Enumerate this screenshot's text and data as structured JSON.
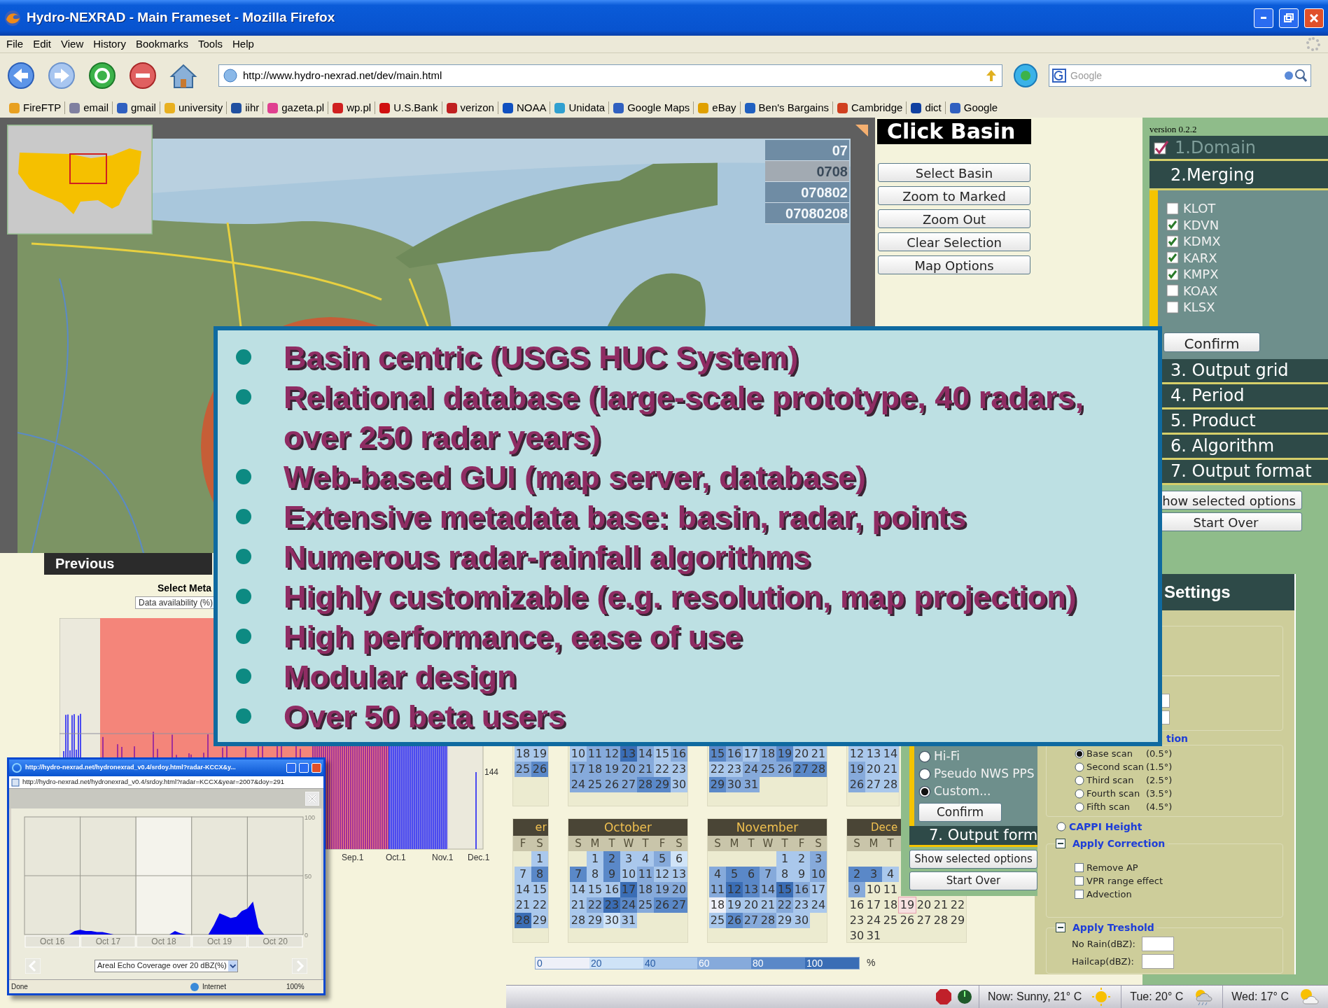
{
  "window": {
    "title": "Hydro-NEXRAD - Main Frameset - Mozilla Firefox"
  },
  "menu": [
    "File",
    "Edit",
    "View",
    "History",
    "Bookmarks",
    "Tools",
    "Help"
  ],
  "toolbar": {
    "url": "http://www.hydro-nexrad.net/dev/main.html",
    "search_placeholder": "Google"
  },
  "bookmarks": [
    {
      "label": "FireFTP",
      "color": "#e8a020"
    },
    {
      "label": "email",
      "color": "#8080a0"
    },
    {
      "label": "gmail",
      "color": "#3060c0"
    },
    {
      "label": "university",
      "color": "#e8b020"
    },
    {
      "label": "iihr",
      "color": "#2050a0"
    },
    {
      "label": "gazeta.pl",
      "color": "#e04090"
    },
    {
      "label": "wp.pl",
      "color": "#d02020"
    },
    {
      "label": "U.S.Bank",
      "color": "#d01010"
    },
    {
      "label": "verizon",
      "color": "#c02020"
    },
    {
      "label": "NOAA",
      "color": "#1050c0"
    },
    {
      "label": "Unidata",
      "color": "#30a0d0"
    },
    {
      "label": "Google Maps",
      "color": "#3060c0"
    },
    {
      "label": "eBay",
      "color": "#e0a000"
    },
    {
      "label": "Ben's Bargains",
      "color": "#2060c0"
    },
    {
      "label": "Cambridge",
      "color": "#d04020"
    },
    {
      "label": "dict",
      "color": "#1040a0"
    },
    {
      "label": "Google",
      "color": "#3060c0"
    }
  ],
  "map": {
    "basin_codes": [
      {
        "code": "07",
        "selected": false
      },
      {
        "code": "0708",
        "selected": true
      },
      {
        "code": "070802",
        "selected": false
      },
      {
        "code": "07080208",
        "selected": false
      }
    ]
  },
  "basin_panel": {
    "title": "Click Basin",
    "buttons": [
      "Select Basin",
      "Zoom to Marked",
      "Zoom Out",
      "Clear Selection",
      "Map Options"
    ]
  },
  "wizard": {
    "version": "version 0.2.2",
    "steps": [
      {
        "label": "1.Domain",
        "done": true,
        "expanded": false
      },
      {
        "label": "2.Merging",
        "done": false,
        "expanded": true
      },
      {
        "label": "3. Output grid",
        "done": false,
        "expanded": false
      },
      {
        "label": "4. Period",
        "done": false,
        "expanded": false
      },
      {
        "label": "5. Product",
        "done": false,
        "expanded": false
      },
      {
        "label": "6. Algorithm",
        "done": false,
        "expanded": false
      },
      {
        "label": "7. Output format",
        "done": false,
        "expanded": false
      }
    ],
    "radars": [
      {
        "label": "KLOT",
        "checked": false
      },
      {
        "label": "KDVN",
        "checked": true
      },
      {
        "label": "KDMX",
        "checked": true
      },
      {
        "label": "KARX",
        "checked": true
      },
      {
        "label": "KMPX",
        "checked": true
      },
      {
        "label": "KOAX",
        "checked": false
      },
      {
        "label": "KLSX",
        "checked": false
      }
    ],
    "confirm": "Confirm",
    "show_options": "how selected options",
    "start_over": "Start Over"
  },
  "previous": "Previous",
  "availability": {
    "label": "Select Meta",
    "dropdown": "Data availability (%)",
    "max_label": "144",
    "x_labels": [
      "Sep.1",
      "Oct.1",
      "Nov.1",
      "Dec.1"
    ]
  },
  "popup": {
    "title": "http://hydro-nexrad.net/hydronexrad_v0.4/srdoy.html?radar-KCCX&y...",
    "address": "http://hydro-nexrad.net/hydronexrad_v0.4/srdoy.html?radar=KCCX&year=2007&doy=291",
    "chart_data": {
      "type": "area",
      "categories": [
        null,
        null,
        null,
        null,
        null,
        "Oct 16",
        null,
        null,
        null,
        null,
        null,
        null,
        null,
        null,
        null,
        "Oct 17",
        null,
        null,
        null,
        null,
        null,
        null,
        null,
        null,
        null,
        "Oct 18",
        null,
        null,
        null,
        null,
        null,
        null,
        null,
        null,
        null,
        "Oct 19",
        null,
        null,
        null,
        null,
        null,
        null,
        null,
        null,
        null,
        "Oct 20",
        null,
        null,
        null,
        null,
        null
      ],
      "series": [
        {
          "name": "Areal Echo Coverage over 20 dBZ(%)",
          "color": "#0000ee",
          "values": [
            0,
            0,
            0,
            0,
            0,
            0,
            0,
            0,
            0,
            3,
            4,
            3,
            3,
            2,
            2,
            1,
            0,
            0,
            0,
            0,
            0,
            0,
            0,
            0,
            0,
            0,
            0,
            3,
            1,
            0,
            0,
            0,
            0,
            0,
            8,
            18,
            16,
            14,
            15,
            20,
            22,
            28,
            6,
            0,
            0,
            0,
            0,
            0,
            0,
            0,
            0
          ]
        }
      ],
      "ylim": [
        0,
        100
      ],
      "yticks": [
        0,
        50,
        100
      ]
    },
    "status": "Done",
    "zone": "Internet",
    "zoom": "100%"
  },
  "calendars": {
    "top": [
      {
        "weeks": [
          [
            {
              "kind": "day",
              "day": "18",
              "color": "#aac8ec"
            },
            {
              "kind": "day",
              "day": "19",
              "color": "#aac8ec"
            }
          ],
          [
            {
              "kind": "day",
              "day": "25",
              "color": "#86aadb"
            },
            {
              "kind": "day",
              "day": "26",
              "color": "#5a88c8"
            }
          ]
        ]
      },
      {
        "weeks": [
          [
            {
              "kind": "day",
              "day": "10",
              "color": "#aac8ec"
            },
            {
              "kind": "day",
              "day": "11",
              "color": "#86aadb"
            },
            {
              "kind": "day",
              "day": "12",
              "color": "#86aadb"
            },
            {
              "kind": "day",
              "day": "13",
              "color": "#3a6db5"
            },
            {
              "kind": "day",
              "day": "14",
              "color": "#86aadb"
            },
            {
              "kind": "day",
              "day": "15",
              "color": "#aac8ec"
            },
            {
              "kind": "day",
              "day": "16",
              "color": "#86aadb"
            }
          ],
          [
            {
              "kind": "day",
              "day": "17",
              "color": "#86aadb"
            },
            {
              "kind": "day",
              "day": "18",
              "color": "#86aadb"
            },
            {
              "kind": "day",
              "day": "19",
              "color": "#86aadb"
            },
            {
              "kind": "day",
              "day": "20",
              "color": "#86aadb"
            },
            {
              "kind": "day",
              "day": "21",
              "color": "#86aadb"
            },
            {
              "kind": "day",
              "day": "22",
              "color": "#aac8ec"
            },
            {
              "kind": "day",
              "day": "23",
              "color": "#aac8ec"
            }
          ],
          [
            {
              "kind": "day",
              "day": "24",
              "color": "#86aadb"
            },
            {
              "kind": "day",
              "day": "25",
              "color": "#86aadb"
            },
            {
              "kind": "day",
              "day": "26",
              "color": "#86aadb"
            },
            {
              "kind": "day",
              "day": "27",
              "color": "#86aadb"
            },
            {
              "kind": "day",
              "day": "28",
              "color": "#5a88c8"
            },
            {
              "kind": "day",
              "day": "29",
              "color": "#5a88c8"
            },
            {
              "kind": "day",
              "day": "30",
              "color": "#aac8ec"
            }
          ]
        ]
      },
      {
        "weeks": [
          [
            {
              "kind": "day",
              "day": "15",
              "color": "#5a88c8"
            },
            {
              "kind": "day",
              "day": "16",
              "color": "#86aadb"
            },
            {
              "kind": "day",
              "day": "17",
              "color": "#aac8ec"
            },
            {
              "kind": "day",
              "day": "18",
              "color": "#86aadb"
            },
            {
              "kind": "day",
              "day": "19",
              "color": "#5a88c8"
            },
            {
              "kind": "day",
              "day": "20",
              "color": "#aac8ec"
            },
            {
              "kind": "day",
              "day": "21",
              "color": "#aac8ec"
            }
          ],
          [
            {
              "kind": "day",
              "day": "22",
              "color": "#aac8ec"
            },
            {
              "kind": "day",
              "day": "23",
              "color": "#aac8ec"
            },
            {
              "kind": "day",
              "day": "24",
              "color": "#86aadb"
            },
            {
              "kind": "day",
              "day": "25",
              "color": "#86aadb"
            },
            {
              "kind": "day",
              "day": "26",
              "color": "#86aadb"
            },
            {
              "kind": "day",
              "day": "27",
              "color": "#5a88c8"
            },
            {
              "kind": "day",
              "day": "28",
              "color": "#5a88c8"
            }
          ],
          [
            {
              "kind": "day",
              "day": "29",
              "color": "#5a88c8"
            },
            {
              "kind": "day",
              "day": "30",
              "color": "#86aadb"
            },
            {
              "kind": "day",
              "day": "31",
              "color": "#86aadb"
            }
          ]
        ]
      },
      {
        "weeks": [
          [
            {
              "kind": "day",
              "day": "12",
              "color": "#aac8ec"
            },
            {
              "kind": "day",
              "day": "13",
              "color": "#aac8ec"
            },
            {
              "kind": "day",
              "day": "14",
              "color": "#aac8ec"
            }
          ],
          [
            {
              "kind": "day",
              "day": "19",
              "color": "#86aadb"
            },
            {
              "kind": "day",
              "day": "20",
              "color": "#aac8ec"
            },
            {
              "kind": "day",
              "day": "21",
              "color": "#aac8ec"
            }
          ],
          [
            {
              "kind": "day",
              "day": "26",
              "color": "#86aadb"
            },
            {
              "kind": "day",
              "day": "27",
              "color": "#aac8ec"
            },
            {
              "kind": "day",
              "day": "28",
              "color": "#aac8ec"
            }
          ]
        ]
      }
    ],
    "bottom": [
      {
        "name": "er",
        "cut_left": true,
        "weekdays": [
          "F",
          "S"
        ],
        "weeks": [
          [
            {
              "kind": "blank"
            },
            {
              "kind": "day",
              "day": "1",
              "color": "#aac8ec"
            }
          ],
          [
            {
              "kind": "day",
              "day": "7",
              "color": "#aac8ec"
            },
            {
              "kind": "day",
              "day": "8",
              "color": "#5a88c8"
            }
          ],
          [
            {
              "kind": "day",
              "day": "14",
              "color": "#aac8ec"
            },
            {
              "kind": "day",
              "day": "15",
              "color": "#aac8ec"
            }
          ],
          [
            {
              "kind": "day",
              "day": "21",
              "color": "#aac8ec"
            },
            {
              "kind": "day",
              "day": "22",
              "color": "#aac8ec"
            }
          ],
          [
            {
              "kind": "day",
              "day": "28",
              "color": "#3a6db5"
            },
            {
              "kind": "day",
              "day": "29",
              "color": "#aac8ec"
            }
          ]
        ]
      },
      {
        "name": "October",
        "weekdays": [
          "S",
          "M",
          "T",
          "W",
          "T",
          "F",
          "S"
        ],
        "weeks": [
          [
            {
              "kind": "blank"
            },
            {
              "kind": "day",
              "day": "1",
              "color": "#aac8ec"
            },
            {
              "kind": "day",
              "day": "2",
              "color": "#5a88c8"
            },
            {
              "kind": "day",
              "day": "3",
              "color": "#aac8ec"
            },
            {
              "kind": "day",
              "day": "4",
              "color": "#aac8ec"
            },
            {
              "kind": "day",
              "day": "5",
              "color": "#86aadb"
            },
            {
              "kind": "day",
              "day": "6",
              "color": "#d0e4f8"
            }
          ],
          [
            {
              "kind": "day",
              "day": "7",
              "color": "#5a88c8"
            },
            {
              "kind": "day",
              "day": "8",
              "color": "#aac8ec"
            },
            {
              "kind": "day",
              "day": "9",
              "color": "#5a88c8"
            },
            {
              "kind": "day",
              "day": "10",
              "color": "#aac8ec"
            },
            {
              "kind": "day",
              "day": "11",
              "color": "#86aadb"
            },
            {
              "kind": "day",
              "day": "12",
              "color": "#aac8ec"
            },
            {
              "kind": "day",
              "day": "13",
              "color": "#aac8ec"
            }
          ],
          [
            {
              "kind": "day",
              "day": "14",
              "color": "#aac8ec"
            },
            {
              "kind": "day",
              "day": "15",
              "color": "#aac8ec"
            },
            {
              "kind": "day",
              "day": "16",
              "color": "#aac8ec"
            },
            {
              "kind": "day",
              "day": "17",
              "color": "#3a6db5"
            },
            {
              "kind": "day",
              "day": "18",
              "color": "#86aadb"
            },
            {
              "kind": "day",
              "day": "19",
              "color": "#86aadb"
            },
            {
              "kind": "day",
              "day": "20",
              "color": "#86aadb"
            }
          ],
          [
            {
              "kind": "day",
              "day": "21",
              "color": "#aac8ec"
            },
            {
              "kind": "day",
              "day": "22",
              "color": "#86aadb"
            },
            {
              "kind": "day",
              "day": "23",
              "color": "#3a6db5"
            },
            {
              "kind": "day",
              "day": "24",
              "color": "#5a88c8"
            },
            {
              "kind": "day",
              "day": "25",
              "color": "#86aadb"
            },
            {
              "kind": "day",
              "day": "26",
              "color": "#5a88c8"
            },
            {
              "kind": "day",
              "day": "27",
              "color": "#5a88c8"
            }
          ],
          [
            {
              "kind": "day",
              "day": "28",
              "color": "#aac8ec"
            },
            {
              "kind": "day",
              "day": "29",
              "color": "#aac8ec"
            },
            {
              "kind": "day",
              "day": "30",
              "color": "#d0e4f8"
            },
            {
              "kind": "day",
              "day": "31",
              "color": "#aac8ec"
            }
          ]
        ]
      },
      {
        "name": "November",
        "weekdays": [
          "S",
          "M",
          "T",
          "W",
          "T",
          "F",
          "S"
        ],
        "weeks": [
          [
            {
              "kind": "blank"
            },
            {
              "kind": "blank"
            },
            {
              "kind": "blank"
            },
            {
              "kind": "blank"
            },
            {
              "kind": "day",
              "day": "1",
              "color": "#aac8ec"
            },
            {
              "kind": "day",
              "day": "2",
              "color": "#aac8ec"
            },
            {
              "kind": "day",
              "day": "3",
              "color": "#86aadb"
            }
          ],
          [
            {
              "kind": "day",
              "day": "4",
              "color": "#86aadb"
            },
            {
              "kind": "day",
              "day": "5",
              "color": "#5a88c8"
            },
            {
              "kind": "day",
              "day": "6",
              "color": "#5a88c8"
            },
            {
              "kind": "day",
              "day": "7",
              "color": "#86aadb"
            },
            {
              "kind": "day",
              "day": "8",
              "color": "#aac8ec"
            },
            {
              "kind": "day",
              "day": "9",
              "color": "#aac8ec"
            },
            {
              "kind": "day",
              "day": "10",
              "color": "#86aadb"
            }
          ],
          [
            {
              "kind": "day",
              "day": "11",
              "color": "#86aadb"
            },
            {
              "kind": "day",
              "day": "12",
              "color": "#3a6db5"
            },
            {
              "kind": "day",
              "day": "13",
              "color": "#5a88c8"
            },
            {
              "kind": "day",
              "day": "14",
              "color": "#86aadb"
            },
            {
              "kind": "day",
              "day": "15",
              "color": "#3a6db5"
            },
            {
              "kind": "day",
              "day": "16",
              "color": "#86aadb"
            },
            {
              "kind": "day",
              "day": "17",
              "color": "#aac8ec"
            }
          ],
          [
            {
              "kind": "day",
              "day": "18",
              "color": "#eef0f8"
            },
            {
              "kind": "day",
              "day": "19",
              "color": "#aac8ec"
            },
            {
              "kind": "day",
              "day": "20",
              "color": "#aac8ec"
            },
            {
              "kind": "day",
              "day": "21",
              "color": "#aac8ec"
            },
            {
              "kind": "day",
              "day": "22",
              "color": "#86aadb"
            },
            {
              "kind": "day",
              "day": "23",
              "color": "#aac8ec"
            },
            {
              "kind": "day",
              "day": "24",
              "color": "#aac8ec"
            }
          ],
          [
            {
              "kind": "day",
              "day": "25",
              "color": "#aac8ec"
            },
            {
              "kind": "day",
              "day": "26",
              "color": "#5a88c8"
            },
            {
              "kind": "day",
              "day": "27",
              "color": "#86aadb"
            },
            {
              "kind": "day",
              "day": "28",
              "color": "#86aadb"
            },
            {
              "kind": "day",
              "day": "29",
              "color": "#aac8ec"
            },
            {
              "kind": "day",
              "day": "30",
              "color": "#aac8ec"
            }
          ]
        ]
      },
      {
        "name": "Dece",
        "cut_right": true,
        "weekdays": [
          "S",
          "M",
          "T"
        ],
        "weeks": [
          [
            {
              "kind": "blank"
            }
          ],
          [
            {
              "kind": "day",
              "day": "2",
              "color": "#5a88c8"
            },
            {
              "kind": "day",
              "day": "3",
              "color": "#5a88c8"
            },
            {
              "kind": "day",
              "day": "4",
              "color": "#aac8ec"
            }
          ],
          [
            {
              "kind": "day",
              "day": "9",
              "color": "#86aadb"
            },
            {
              "kind": "day",
              "day": "10"
            },
            {
              "kind": "day",
              "day": "11"
            }
          ],
          [
            {
              "kind": "day",
              "day": "16"
            },
            {
              "kind": "day",
              "day": "17"
            },
            {
              "kind": "day",
              "day": "18"
            },
            {
              "kind": "day",
              "day": "19",
              "today": true
            },
            {
              "kind": "day",
              "day": "20"
            },
            {
              "kind": "day",
              "day": "21"
            },
            {
              "kind": "day",
              "day": "22"
            }
          ],
          [
            {
              "kind": "day",
              "day": "23"
            },
            {
              "kind": "day",
              "day": "24"
            },
            {
              "kind": "day",
              "day": "25"
            },
            {
              "kind": "day",
              "day": "26"
            },
            {
              "kind": "day",
              "day": "27"
            },
            {
              "kind": "day",
              "day": "28"
            },
            {
              "kind": "day",
              "day": "29"
            }
          ],
          [
            {
              "kind": "day",
              "day": "30"
            },
            {
              "kind": "day",
              "day": "31"
            }
          ]
        ]
      }
    ],
    "legend": {
      "labels": [
        "0",
        "20",
        "40",
        "60",
        "80",
        "100"
      ],
      "unit": "%"
    }
  },
  "output_panel": {
    "options": [
      {
        "label": "Hi-Fi",
        "selected": false
      },
      {
        "label": "Pseudo NWS PPS",
        "selected": false
      },
      {
        "label": "Custom...",
        "selected": true
      }
    ],
    "confirm": "Confirm",
    "step": "7. Output form",
    "show_options": "Show selected options",
    "start_over": "Start Over"
  },
  "settings": {
    "title": "Settings",
    "scan_legend": "tion",
    "scans": [
      {
        "label": "Base scan",
        "angle": "(0.5°)",
        "selected": true
      },
      {
        "label": "Second scan",
        "angle": "(1.5°)",
        "selected": false
      },
      {
        "label": "Third scan",
        "angle": "(2.5°)",
        "selected": false
      },
      {
        "label": "Fourth scan",
        "angle": "(3.5°)",
        "selected": false
      },
      {
        "label": "Fifth scan",
        "angle": "(4.5°)",
        "selected": false
      }
    ],
    "cappi": {
      "label": "CAPPI Height",
      "selected": false
    },
    "correction": {
      "label": "Apply Correction",
      "expanded": true,
      "options": [
        {
          "label": "Remove AP",
          "checked": false
        },
        {
          "label": "VPR range effect",
          "checked": false
        },
        {
          "label": "Advection",
          "checked": false
        }
      ]
    },
    "threshold": {
      "label": "Apply Treshold",
      "expanded": true,
      "fields": [
        {
          "label": "No Rain(dBZ):"
        },
        {
          "label": "Hailcap(dBZ):"
        }
      ]
    }
  },
  "slide": {
    "bullets": [
      "Basin centric (USGS HUC System)",
      "Relational database (large-scale prototype, 40 radars, over 250 radar years)",
      "Web-based GUI (map server, database)",
      "Extensive metadata base: basin, radar, points",
      "Numerous radar-rainfall algorithms",
      "Highly customizable (e.g. resolution, map projection)",
      "High performance, ease of use",
      "Modular design",
      "Over 50 beta users"
    ]
  },
  "status_bar": {
    "items": [
      {
        "text": "Now: Sunny, 21° C",
        "kind": "sunny"
      },
      {
        "text": "Tue: 20° C",
        "kind": "rain"
      },
      {
        "text": "Wed: 17° C",
        "kind": "partly-cloudy"
      }
    ]
  }
}
